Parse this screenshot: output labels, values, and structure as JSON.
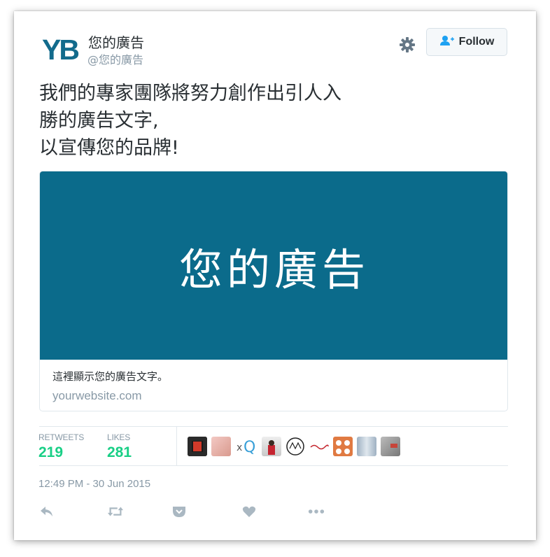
{
  "header": {
    "logo_text": "YB",
    "display_name": "您的廣告",
    "handle": "@您的廣告",
    "follow_label": "Follow"
  },
  "tweet": {
    "text": "我們的專家團隊將努力創作出引人入\n勝的廣告文字,\n以宣傳您的品牌!"
  },
  "card": {
    "image_text": "您的廣告",
    "description": "這裡顯示您的廣告文字。",
    "url": "yourwebsite.com"
  },
  "stats": {
    "retweets_label": "RETWEETS",
    "retweets_value": "219",
    "likes_label": "LIKES",
    "likes_value": "281"
  },
  "timestamp": "12:49 PM - 30 Jun 2015",
  "actions": [
    "reply-icon",
    "retweet-icon",
    "pocket-icon",
    "heart-icon",
    "more-icon"
  ],
  "colors": {
    "brand": "#126b8c",
    "card_background": "#0b6b8b",
    "stat_value": "#19cf86",
    "muted_text": "#8899a6",
    "follow_icon": "#1da1f2"
  }
}
